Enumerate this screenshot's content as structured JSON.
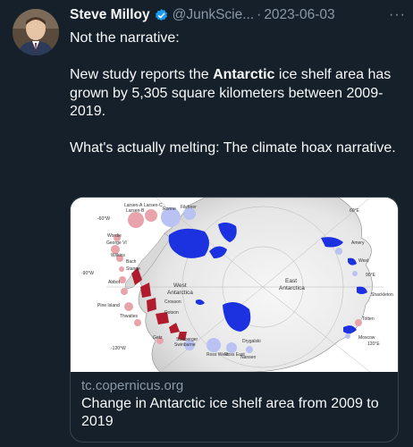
{
  "tweet": {
    "author_name": "Steve Milloy",
    "handle": "@JunkScie...",
    "separator": "·",
    "date": "2023-06-03",
    "more": "···",
    "lines": [
      "Not the narrative:",
      "",
      "New study reports the",
      "Antarctic",
      "ice shelf area has grown by 5,305 square kilometers between 2009-2019.",
      "",
      "What's actually melting: The climate hoax narrative."
    ]
  },
  "card": {
    "domain": "tc.copernicus.org",
    "title": "Change in Antarctic ice shelf area from 2009 to 2019",
    "map_labels": {
      "west": "West",
      "west2": "Antarctica",
      "east": "East",
      "east2": "Antarctica",
      "lon_60w": "-60°W",
      "lon_90w": "-90°W",
      "lon_120w": "-120°W",
      "lon_60e": "60°E",
      "lon_90e": "90°E",
      "lon_120e": "120°E",
      "shelf_larsen_a": "Larsen-A",
      "shelf_larsen_c": "Larsen-C",
      "shelf_larsen_b": "Larsen-B",
      "shelf_ronne": "Ronne",
      "shelf_filchner": "Filchner",
      "shelf_wordie": "Wordie",
      "shelf_george6": "George VI",
      "shelf_wilkins": "Wilkins",
      "shelf_bach": "Bach",
      "shelf_stange": "Stange",
      "shelf_abbot": "Abbot",
      "shelf_pine": "Pine Island",
      "shelf_thwaites": "Thwaites",
      "shelf_crosson": "Crosson",
      "shelf_dotson": "Dotson",
      "shelf_getz": "Getz",
      "shelf_sulzberger": "Sulzberger",
      "shelf_swinburne": "Swinburne",
      "shelf_ross_w": "Ross West",
      "shelf_ross_e": "Ross East",
      "shelf_drygalski": "Drygalski",
      "shelf_nansen": "Nansen",
      "shelf_amery": "Amery",
      "shelf_west": "West",
      "shelf_shackleton": "Shackleton",
      "shelf_totten": "Totten",
      "shelf_moscow": "Moscow"
    }
  },
  "colors": {
    "background": "#15202b",
    "text": "#f7f9f9",
    "muted": "#8b98a5",
    "border": "#38444d",
    "verified": "#1d9bf0",
    "gain": "#1c31e0",
    "loss": "#b01c2e"
  },
  "icons": {
    "verified": "verified-badge-icon",
    "more": "more-horizontal-icon"
  }
}
